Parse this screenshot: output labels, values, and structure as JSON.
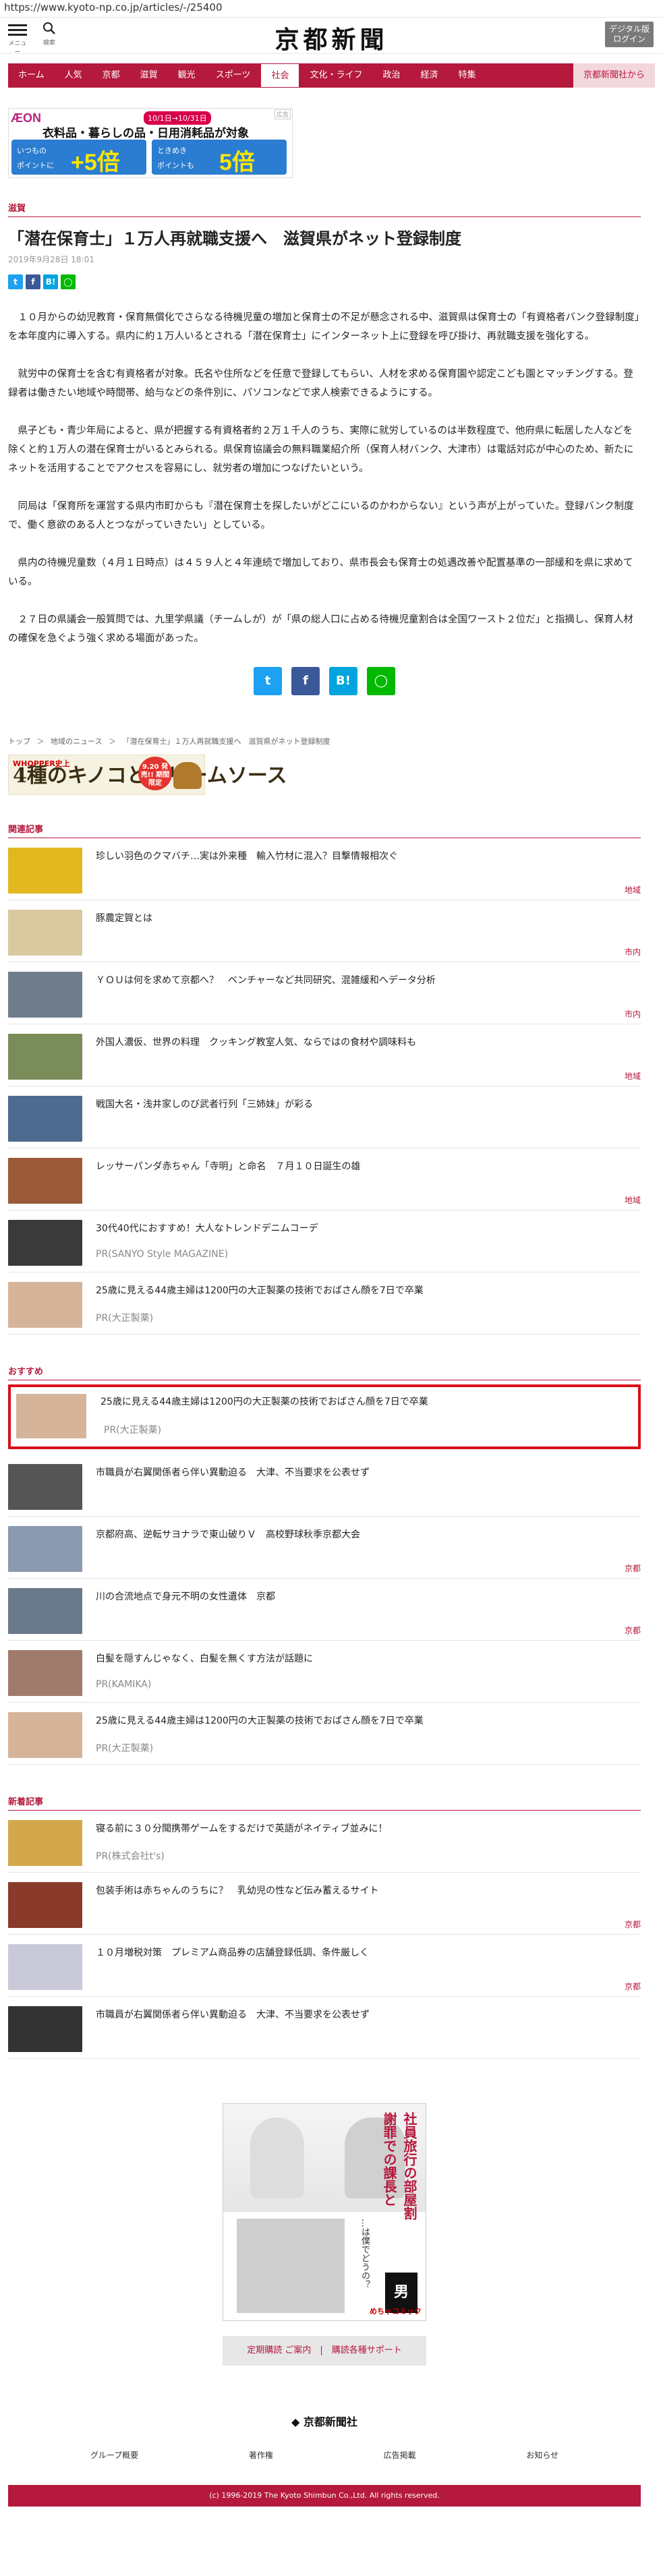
{
  "url": "https://www.kyoto-np.co.jp/articles/-/25400",
  "header": {
    "menu_label": "メニュー",
    "search_label": "検索",
    "logo": "京都新聞",
    "login_line1": "デジタル版",
    "login_line2": "ログイン"
  },
  "nav": [
    "ホーム",
    "人気",
    "京都",
    "滋賀",
    "観光",
    "スポーツ",
    "社会",
    "文化・ライフ",
    "政治",
    "経済",
    "特集"
  ],
  "nav_active": "社会",
  "nav_kyoto": "京都新聞社から",
  "ad1": {
    "label": "広告",
    "brand": "ÆON",
    "date": "10/1日→10/31日",
    "head": "衣料品・暮らしの品・日用消耗品が対象",
    "left_top": "いつもの",
    "left_bottom": "ポイントに",
    "left_big": "+5倍",
    "right_top": "ときめき",
    "right_bottom": "ポイントも",
    "right_big": "5倍"
  },
  "article": {
    "section": "滋賀",
    "title": "「潜在保育士」１万人再就職支援へ　滋賀県がネット登録制度",
    "date": "2019年9月28日 18:01",
    "paragraphs": [
      "　１０月からの幼児教育・保育無償化でさらなる待機児童の増加と保育士の不足が懸念される中、滋賀県は保育士の「有資格者バンク登録制度」を本年度内に導入する。県内に約１万人いるとされる「潜在保育士」にインターネット上に登録を呼び掛け、再就職支援を強化する。",
      "　就労中の保育士を含む有資格者が対象。氏名や住所などを任意で登録してもらい、人材を求める保育園や認定こども園とマッチングする。登録者は働きたい地域や時間帯、給与などの条件別に、パソコンなどで求人検索できるようにする。",
      "　県子ども・青少年局によると、県が把握する有資格者約２万１千人のうち、実際に就労しているのは半数程度で、他府県に転居した人などを除くと約１万人の潜在保育士がいるとみられる。県保育協議会の無料職業紹介所（保育人材バンク、大津市）は電話対応が中心のため、新たにネットを活用することでアクセスを容易にし、就労者の増加につなげたいという。",
      "　同局は「保育所を運営する県内市町からも『潜在保育士を探したいがどこにいるのかわからない』という声が上がっていた。登録バンク制度で、働く意欲のある人とつながっていきたい」としている。",
      "　県内の待機児童数（４月１日時点）は４５９人と４年連続で増加しており、県市長会も保育士の処遇改善や配置基準の一部緩和を県に求めている。",
      "　２７日の県議会一般質問では、九里学県議（チームしが）が「県の総人口に占める待機児童割合は全国ワースト２位だ」と指摘し、保育人材の確保を急ぐよう強く求める場面があった。"
    ]
  },
  "breadcrumb": {
    "top": "トップ",
    "sep": "＞",
    "local": "地域のニュース",
    "current": "「潜在保育士」１万人再就職支援へ　滋賀県がネット登録制度"
  },
  "ad2": {
    "small": "WHOPPER史上",
    "big": "4種のキノコとクリームソース",
    "badge": "9.20 発売!! 期間限定"
  },
  "related": {
    "heading": "関連記事",
    "items": [
      {
        "title": "珍しい羽色のクマバチ…実は外来種　輸入竹材に混入？目撃情報相次ぐ",
        "cat": "地域",
        "pr": ""
      },
      {
        "title": "豚農定賀とは",
        "cat": "市内",
        "pr": ""
      },
      {
        "title": "ＹＯＵは何を求めて京都へ？　ベンチャーなど共同研究、混雑緩和へデータ分析",
        "cat": "市内",
        "pr": ""
      },
      {
        "title": "外国人濃仮、世界の料理　クッキング教室人気、ならではの食材や調味料も",
        "cat": "地域",
        "pr": ""
      },
      {
        "title": "戦国大名・浅井家しのび武者行列「三姉妹」が彩る",
        "cat": "",
        "pr": ""
      },
      {
        "title": "レッサーパンダ赤ちゃん「寺明」と命名　７月１０日誕生の雄",
        "cat": "地域",
        "pr": ""
      },
      {
        "title": "30代40代におすすめ！大人なトレンドデニムコーデ",
        "cat": "",
        "pr": "PR(SANYO Style MAGAZINE)"
      },
      {
        "title": "25歳に見える44歳主婦は1200円の大正製薬の技術でおばさん顔を7日で卒業",
        "cat": "",
        "pr": "PR(大正製薬)"
      }
    ]
  },
  "recommend": {
    "heading": "おすすめ",
    "items": [
      {
        "title": "25歳に見える44歳主婦は1200円の大正製薬の技術でおばさん顔を7日で卒業",
        "cat": "",
        "pr": "PR(大正製薬)"
      },
      {
        "title": "市職員が右翼関係者ら伴い異動迫る　大津、不当要求を公表せず",
        "cat": "",
        "pr": ""
      },
      {
        "title": "京都府高、逆転サヨナラで東山破りＶ　高校野球秋季京都大会",
        "cat": "京都",
        "pr": ""
      },
      {
        "title": "川の合流地点で身元不明の女性遺体　京都",
        "cat": "京都",
        "pr": ""
      },
      {
        "title": "白髪を隠すんじゃなく、白髪を無くす方法が話題に",
        "cat": "",
        "pr": "PR(KAMIKA)"
      },
      {
        "title": "25歳に見える44歳主婦は1200円の大正製薬の技術でおばさん顔を7日で卒業",
        "cat": "",
        "pr": "PR(大正製薬)"
      }
    ]
  },
  "newest": {
    "heading": "新着記事",
    "items": [
      {
        "title": "寝る前に３０分聞携帯ゲームをするだけで英語がネイティブ並みに！",
        "cat": "",
        "pr": "PR(株式会社t's)"
      },
      {
        "title": "包装手術は赤ちゃんのうちに？　乳幼児の性など伝み蓄えるサイト",
        "cat": "京都",
        "pr": ""
      },
      {
        "title": "１０月増税対策　プレミアム商品券の店舗登録低調、条件厳しく",
        "cat": "京都",
        "pr": ""
      },
      {
        "title": "市職員が右翼関係者ら伴い異動迫る　大津、不当要求を公表せず",
        "cat": "",
        "pr": ""
      }
    ]
  },
  "ad3": {
    "v1": "社員旅行の部屋割",
    "v2": "謝罪での課長と",
    "v3": "…は僕でどうの？",
    "brand": "めちゃコミック"
  },
  "footer": {
    "links": "定期購読 ご案内　|　購読各種サポート",
    "logo": "京都新聞社",
    "nav": [
      "グループ概要",
      "著作権",
      "広告掲載",
      "お知らせ"
    ],
    "copyright": "(c) 1996-2019 The Kyoto Shimbun Co.,Ltd. All rights reserved."
  },
  "colors": {
    "brand": "#b5193d",
    "highlight": "#d8101a"
  }
}
